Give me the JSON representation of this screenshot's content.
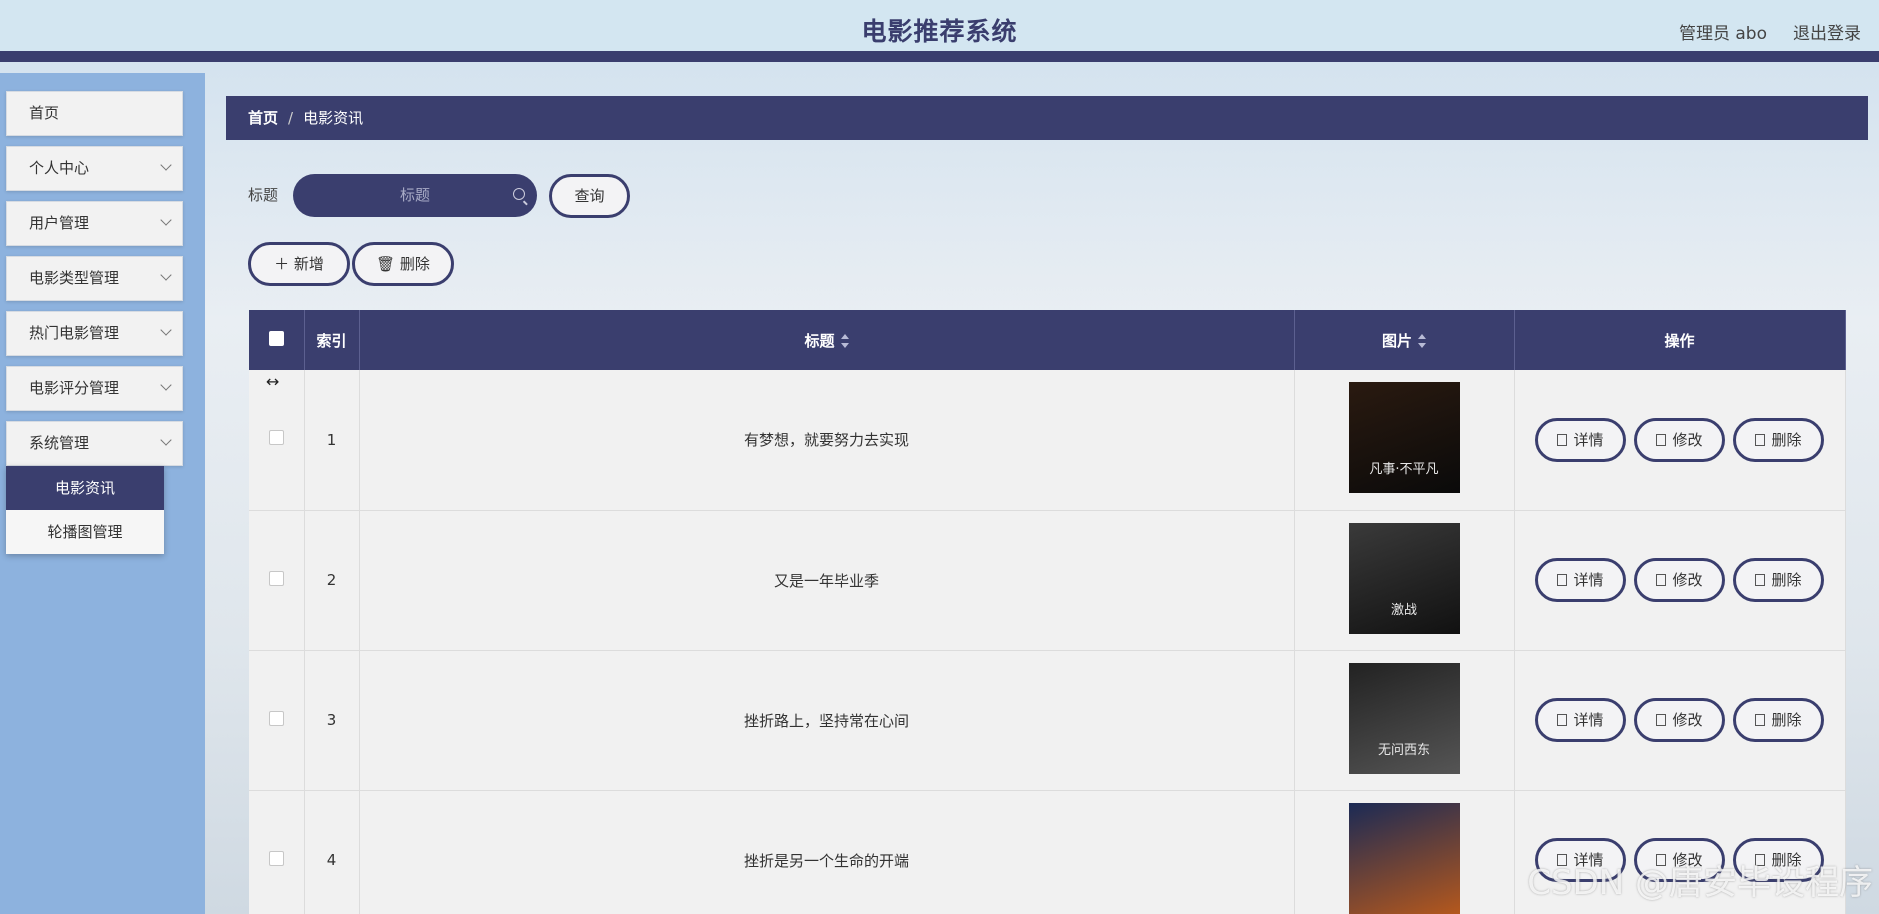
{
  "header": {
    "title": "电影推荐系统",
    "user": "管理员 abo",
    "logout": "退出登录"
  },
  "sidebar": {
    "items": [
      {
        "label": "首页"
      },
      {
        "label": "个人中心"
      },
      {
        "label": "用户管理"
      },
      {
        "label": "电影类型管理"
      },
      {
        "label": "热门电影管理"
      },
      {
        "label": "电影评分管理"
      },
      {
        "label": "系统管理"
      }
    ],
    "submenu": [
      {
        "label": "电影资讯",
        "active": true
      },
      {
        "label": "轮播图管理"
      }
    ]
  },
  "breadcrumb": {
    "home": "首页",
    "separator": "/",
    "current": "电影资讯"
  },
  "search": {
    "label": "标题",
    "placeholder": "标题",
    "button": "查询"
  },
  "toolbar": {
    "add": "新增",
    "delete": "删除"
  },
  "table": {
    "columns": [
      "索引",
      "标题",
      "图片",
      "操作"
    ],
    "rows": [
      {
        "index": "1",
        "title": "有梦想，就要努力去实现",
        "poster_text": "凡事·不平凡",
        "poster_colors": [
          "#2a1a10",
          "#0a0a0a"
        ]
      },
      {
        "index": "2",
        "title": "又是一年毕业季",
        "poster_text": "激战",
        "poster_colors": [
          "#3a3a3a",
          "#111"
        ]
      },
      {
        "index": "3",
        "title": "挫折路上，坚持常在心间",
        "poster_text": "无问西东",
        "poster_colors": [
          "#222",
          "#555"
        ]
      },
      {
        "index": "4",
        "title": "挫折是另一个生命的开端",
        "poster_text": "",
        "poster_colors": [
          "#1b2a55",
          "#b4581d"
        ]
      }
    ],
    "actions": {
      "detail": "详情",
      "edit": "修改",
      "delete": "删除"
    }
  },
  "watermark": "CSDN @唐安毕设程序"
}
